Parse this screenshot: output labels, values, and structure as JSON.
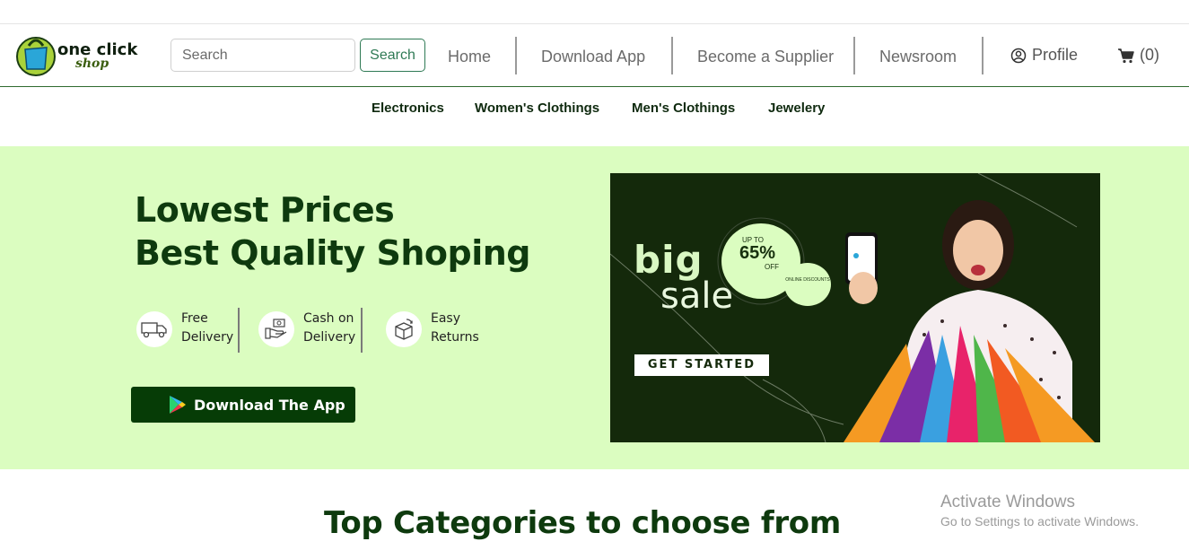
{
  "header": {
    "logo_alt": "one click shop",
    "search": {
      "placeholder": "Search",
      "value": "",
      "button_label": "Search"
    },
    "nav": [
      {
        "label": "Home"
      },
      {
        "label": "Download App"
      },
      {
        "label": "Become a Supplier"
      },
      {
        "label": "Newsroom"
      }
    ],
    "profile_label": "Profile",
    "cart_label": "(0)"
  },
  "categories": [
    {
      "label": "Electronics"
    },
    {
      "label": "Women's Clothings"
    },
    {
      "label": "Men's Clothings"
    },
    {
      "label": "Jewelery"
    }
  ],
  "hero": {
    "title_line1": "Lowest Prices",
    "title_line2": "Best Quality Shoping",
    "features": [
      {
        "line1": "Free",
        "line2": "Delivery",
        "icon": "truck-icon"
      },
      {
        "line1": "Cash on",
        "line2": "Delivery",
        "icon": "cash-icon"
      },
      {
        "line1": "Easy",
        "line2": "Returns",
        "icon": "returns-box-icon"
      }
    ],
    "download_button": "Download The App",
    "banner": {
      "big": "big",
      "sale": "sale",
      "up_to": "UP TO",
      "percent": "65%",
      "off": "OFF",
      "online": "ONLINE DISCOUNTS",
      "cta": "GET STARTED"
    }
  },
  "section_title": "Top Categories to choose from",
  "watermark": {
    "line1": "Activate Windows",
    "line2": "Go to Settings to activate Windows."
  },
  "colors": {
    "brand_green": "#0e3a0e",
    "hero_bg": "#dbfdc0",
    "banner_bg": "#14290b",
    "accent": "#2f7a55"
  }
}
